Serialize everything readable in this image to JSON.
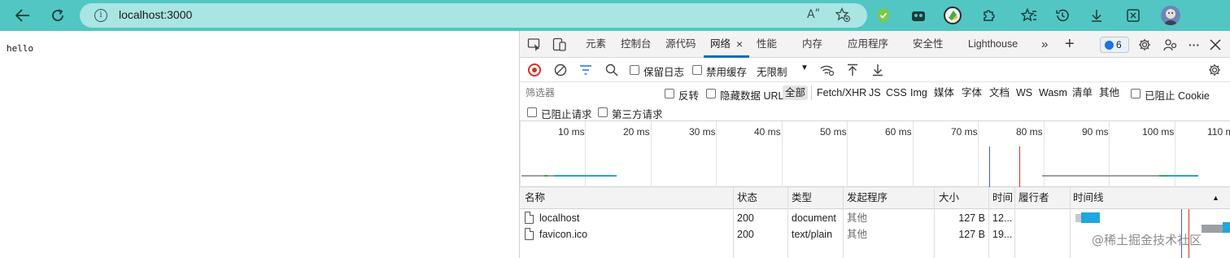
{
  "browser": {
    "url": "localhost:3000",
    "nav_icons": [
      "back-arrow-icon",
      "refresh-icon"
    ],
    "info_glyph": "i",
    "address_right_icons": [
      "read-aloud-icon",
      "add-favorite-icon"
    ],
    "read_aloud_glyph": "Aʺ",
    "toolbar_right_icons": [
      "shield-extension-icon",
      "collections-icon",
      "green-extension-icon",
      "extensions-icon",
      "favorites-icon",
      "history-icon",
      "downloads-icon",
      "screenshot-icon",
      "profile-avatar"
    ]
  },
  "page": {
    "text": "hello"
  },
  "devtools": {
    "tabs": [
      "元素",
      "控制台",
      "源代码",
      "网络",
      "性能",
      "内存",
      "应用程序",
      "安全性",
      "Lighthouse"
    ],
    "active_tab": "网络",
    "issues_count": "6",
    "toolbar": {
      "preserve_log": "保留日志",
      "disable_cache": "禁用缓存",
      "throttling": "无限制"
    },
    "filter": {
      "placeholder": "筛选器",
      "invert": "反转",
      "hide_data_urls": "隐藏数据 URL",
      "types": [
        "全部",
        "Fetch/XHR",
        "JS",
        "CSS",
        "Img",
        "媒体",
        "字体",
        "文档",
        "WS",
        "Wasm",
        "清单",
        "其他"
      ],
      "active_type": "全部",
      "blocked_cookies": "已阻止 Cookie",
      "blocked_requests": "已阻止请求",
      "third_party": "第三方请求"
    },
    "overview": {
      "time_labels": [
        "10 ms",
        "20 ms",
        "30 ms",
        "40 ms",
        "50 ms",
        "60 ms",
        "70 ms",
        "80 ms",
        "90 ms",
        "100 ms",
        "110 ms"
      ],
      "dom_content_loaded_color": "#3b5bdb",
      "load_color": "#d93025",
      "request_color": "#1ea7e0"
    },
    "table": {
      "columns": [
        "名称",
        "状态",
        "类型",
        "发起程序",
        "大小",
        "时间",
        "履行者",
        "时间线"
      ],
      "rows": [
        {
          "name": "localhost",
          "status": "200",
          "type": "document",
          "initiator": "其他",
          "size": "127 B",
          "time": "12..."
        },
        {
          "name": "favicon.ico",
          "status": "200",
          "type": "text/plain",
          "initiator": "其他",
          "size": "127 B",
          "time": "19..."
        }
      ]
    }
  },
  "watermark": "@稀土掘金技术社区"
}
